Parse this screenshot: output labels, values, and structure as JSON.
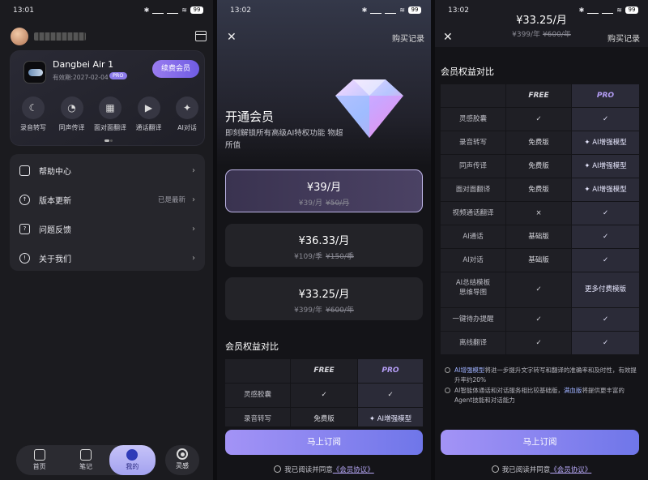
{
  "p1": {
    "time": "13:01",
    "battery": "99",
    "device": {
      "name": "Dangbei Air 1",
      "expire": "有效期:2027-02-04",
      "badge": "PRO",
      "renew": "续费会员"
    },
    "features": [
      {
        "label": "录音转写",
        "icon": "mic-icon"
      },
      {
        "label": "同声传译",
        "icon": "translate-icon"
      },
      {
        "label": "面对面翻译",
        "icon": "face-translate-icon"
      },
      {
        "label": "通话翻译",
        "icon": "call-icon"
      },
      {
        "label": "AI对话",
        "icon": "chat-icon"
      }
    ],
    "menu": [
      {
        "label": "帮助中心",
        "value": ""
      },
      {
        "label": "版本更新",
        "value": "已是最新"
      },
      {
        "label": "问题反馈",
        "value": ""
      },
      {
        "label": "关于我们",
        "value": ""
      }
    ],
    "tabs": [
      "首页",
      "笔记",
      "我的"
    ],
    "lingan": "灵感"
  },
  "p2": {
    "time": "13:02",
    "battery": "99",
    "history": "购买记录",
    "title": "开通会员",
    "subtitle": "即刻解锁所有高级AI特权功能 物超所值",
    "plans": [
      {
        "price": "¥39/月",
        "now": "¥39/月",
        "orig": "¥50/月"
      },
      {
        "price": "¥36.33/月",
        "now": "¥109/季",
        "orig": "¥150/季"
      },
      {
        "price": "¥33.25/月",
        "now": "¥399/年",
        "orig": "¥600/年"
      }
    ],
    "section": "会员权益对比",
    "head": [
      "",
      "FREE",
      "PRO"
    ],
    "rows": [
      [
        "灵感胶囊",
        "✓",
        "✓"
      ],
      [
        "录音转写",
        "免费版",
        "✦ AI增强模型"
      ]
    ],
    "subscribe": "马上订阅",
    "agree": "我已阅读并同意",
    "agreement": "《会员协议》"
  },
  "p3": {
    "time": "13:02",
    "battery": "99",
    "price": "¥33.25/月",
    "now": "¥399/年",
    "orig": "¥600/年",
    "history": "购买记录",
    "section": "会员权益对比",
    "head": [
      "",
      "FREE",
      "PRO"
    ],
    "rows": [
      [
        "灵感胶囊",
        "✓",
        "✓"
      ],
      [
        "录音转写",
        "免费版",
        "✦ AI增强模型"
      ],
      [
        "同声传译",
        "免费版",
        "✦ AI增强模型"
      ],
      [
        "面对面翻译",
        "免费版",
        "✦ AI增强模型"
      ],
      [
        "视频通话翻译",
        "×",
        "✓"
      ],
      [
        "AI通话",
        "基础版",
        "✓"
      ],
      [
        "AI对话",
        "基础版",
        "✓"
      ],
      [
        "AI总结模板 思维导图",
        "✓",
        "更多付费模版"
      ],
      [
        "一键待办提醒",
        "✓",
        "✓"
      ],
      [
        "离线翻译",
        "✓",
        "✓"
      ]
    ],
    "note1_hl": "AI增强模型",
    "note1": "将进一步提升文字转写和翻译的准确率和及时性，有效提升率约20%",
    "note2a": "AI智能体通话和对话服务相比较基础版，",
    "note2_hl": "满血版",
    "note2b": "将提供更丰富的Agent技能和对话能力",
    "subscribe": "马上订阅",
    "agree": "我已阅读并同意",
    "agreement": "《会员协议》"
  }
}
